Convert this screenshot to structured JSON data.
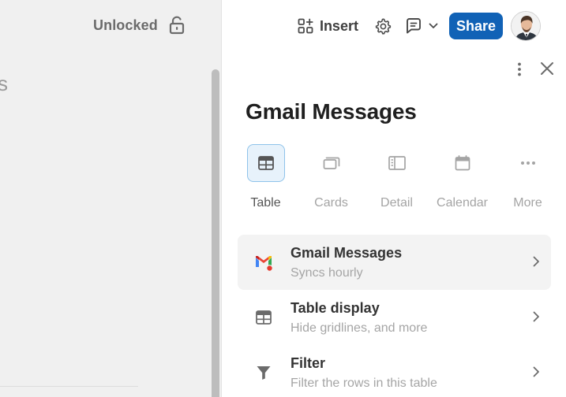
{
  "canvas": {
    "lock_status": "Unlocked",
    "partial_heading": "s"
  },
  "toolbar": {
    "insert_label": "Insert",
    "share_label": "Share"
  },
  "panel": {
    "title": "Gmail Messages",
    "view_types": [
      {
        "label": "Table",
        "icon": "table-icon",
        "active": true
      },
      {
        "label": "Cards",
        "icon": "cards-icon"
      },
      {
        "label": "Detail",
        "icon": "detail-icon"
      },
      {
        "label": "Calendar",
        "icon": "calendar-icon"
      },
      {
        "label": "More",
        "icon": "more-icon"
      }
    ],
    "settings": [
      {
        "title": "Gmail Messages",
        "subtitle": "Syncs hourly",
        "icon": "gmail-icon"
      },
      {
        "title": "Table display",
        "subtitle": "Hide gridlines, and more",
        "icon": "table-icon"
      },
      {
        "title": "Filter",
        "subtitle": "Filter the rows in this table",
        "icon": "filter-icon"
      }
    ]
  },
  "colors": {
    "accent": "#1162b6",
    "active_view_bg": "#e7f2fb",
    "active_view_border": "#8fc3ea"
  }
}
